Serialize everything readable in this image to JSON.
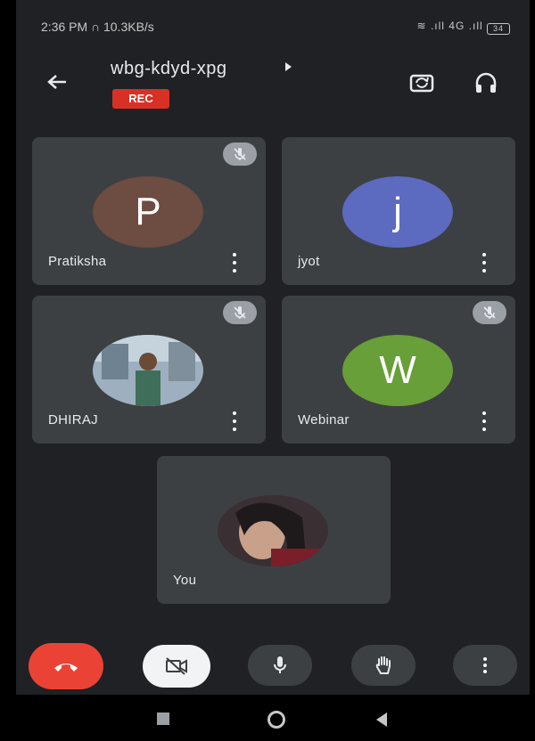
{
  "status_bar": {
    "time": "2:36 PM",
    "speed": "10.3KB/s",
    "network": "4G",
    "battery": "34"
  },
  "header": {
    "meeting_code": "wbg-kdyd-xpg",
    "rec_label": "REC",
    "icons": [
      "back-arrow-icon",
      "switch-camera-icon",
      "headphones-icon"
    ]
  },
  "participants": [
    {
      "name": "Pratiksha",
      "initial": "P",
      "avatar_color": "#6d4c41",
      "muted": true
    },
    {
      "name": "jyot",
      "initial": "j",
      "avatar_color": "#5c6bc0",
      "muted": false
    },
    {
      "name": "DHIRAJ",
      "initial": "",
      "avatar_color": "#8a9baa",
      "muted": true
    },
    {
      "name": "Webinar",
      "initial": "W",
      "avatar_color": "#689f38",
      "muted": true
    },
    {
      "name": "You",
      "initial": "",
      "avatar_color": "#4a3b3b",
      "muted": false
    }
  ],
  "controls": {
    "end_call_color": "#ea4335",
    "buttons": [
      "end-call",
      "camera-off",
      "microphone",
      "raise-hand",
      "more-options"
    ]
  }
}
